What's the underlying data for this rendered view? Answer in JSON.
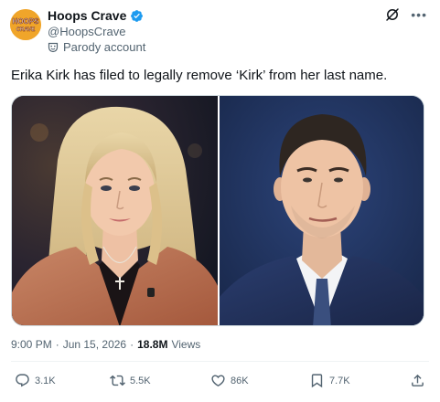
{
  "author": {
    "display_name": "Hoops Crave",
    "handle": "@HoopsCrave",
    "label": "Parody account",
    "avatar_text_top": "HOOPS",
    "avatar_text_bottom": "CRAVE",
    "avatar_color": "#f0a52a"
  },
  "icons": {
    "verified": "verified-badge-icon",
    "parody": "parody-mask-icon",
    "grok": "grok-icon",
    "more": "more-icon"
  },
  "tweet": {
    "text": "Erika Kirk has filed to legally remove ‘Kirk’ from her last name."
  },
  "meta": {
    "time": "9:00 PM",
    "separator": "·",
    "date": "Jun 15, 2026",
    "separator2": "·",
    "views_count": "18.8M",
    "views_label": "Views"
  },
  "actions": {
    "replies": "3.1K",
    "reposts": "5.5K",
    "likes": "86K",
    "bookmarks": "7.7K"
  },
  "colors": {
    "accent": "#1d9bf0",
    "text_secondary": "#536471"
  }
}
